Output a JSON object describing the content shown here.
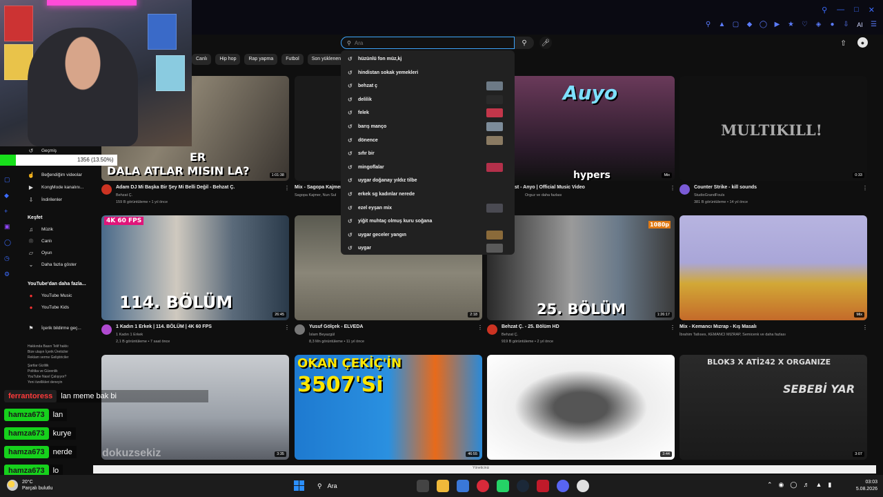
{
  "search": {
    "placeholder": "Ara",
    "suggestions": [
      {
        "text": "hüzünlü fon müz,kj",
        "thumb": ""
      },
      {
        "text": "hindistan sokak yemekleri",
        "thumb": ""
      },
      {
        "text": "behzat ç",
        "thumb": "#6d7a86"
      },
      {
        "text": "delilik",
        "thumb": "#2a2a2a"
      },
      {
        "text": "felek",
        "thumb": "#c3364a"
      },
      {
        "text": "barış manço",
        "thumb": "#7d8c9a"
      },
      {
        "text": "dönence",
        "thumb": "#8a7a62"
      },
      {
        "text": "sıfır bir",
        "thumb": ""
      },
      {
        "text": "mingoflalar",
        "thumb": "#b3304a"
      },
      {
        "text": "uygar doğanay yıldız tilbe",
        "thumb": ""
      },
      {
        "text": "erkek sg kadınlar nerede",
        "thumb": ""
      },
      {
        "text": "ezel eyşan mix",
        "thumb": "#4a4a52"
      },
      {
        "text": "yiğit muhtaç olmuş kuru soğana",
        "thumb": ""
      },
      {
        "text": "uygar geceler yangın",
        "thumb": "#8a6a3a"
      },
      {
        "text": "uygar",
        "thumb": "#5a5a5a"
      }
    ]
  },
  "chips": [
    "Canlı",
    "Hip hop",
    "Rap yapma",
    "Futbol",
    "Son yüklenenler"
  ],
  "sidebar": {
    "history": "Geçmiş",
    "items": [
      {
        "label": "Beğendiğim videolar",
        "icon": "thumb-up-icon"
      },
      {
        "label": "KongMode kanalını...",
        "icon": "play-square-icon"
      },
      {
        "label": "İndirilenler",
        "icon": "download-icon"
      }
    ],
    "explore_title": "Keşfet",
    "explore": [
      {
        "label": "Müzik",
        "icon": "music-icon"
      },
      {
        "label": "Canlı",
        "icon": "live-icon"
      },
      {
        "label": "Oyun",
        "icon": "gamepad-icon"
      },
      {
        "label": "Daha fazla göster",
        "icon": "chevron-down-icon"
      }
    ],
    "more_title": "YouTube'dan daha fazla...",
    "more": [
      {
        "label": "YouTube Music",
        "icon": "yt-music-icon"
      },
      {
        "label": "YouTube Kids",
        "icon": "yt-kids-icon"
      }
    ],
    "report": "İçerik bildirme geç...",
    "footer": [
      "Hakkında  Basın  Telif hakkı",
      "Bize ulaşın  İçerik Üreticiler",
      "Reklam verme  Geliştiriciler",
      "",
      "Şartlar  Gizlilik",
      "Politika ve Güvenlik",
      "YouTube Nasıl Çalışıyor?",
      "Yeni özellikleri deneyin"
    ]
  },
  "progress": {
    "text": "1356 (13.50%)",
    "fraction": 0.135
  },
  "videos": [
    {
      "title": "Adam DJ Mi Başka Bir Şey Mi Belli Değil - Behzat Ç.",
      "channel": "Behzat Ç.",
      "meta": "159 B görüntüleme • 1 yıl önce",
      "duration": "1:01:38",
      "overlay": "DALA ATLAR MISIN LA?",
      "overlay2": "ER"
    },
    {
      "title": "Mix - Sagopa Kajmer",
      "channel": "Sagopa Kajmer, Nun Sul",
      "meta": "",
      "duration": "",
      "overlay": "",
      "overlay2": ""
    },
    {
      "title": "st - Anyo | Official Music Video",
      "channel": "Orguz ve daha fazlası",
      "meta": "",
      "duration": "Mix",
      "overlay": "Auyo",
      "overlay2": "hypers"
    },
    {
      "title": "Counter Strike - kill sounds",
      "channel": "StudioGrandFouls",
      "meta": "381 B görüntüleme • 14 yıl önce",
      "duration": "0:33",
      "overlay": "MULTIKILL!",
      "overlay2": ""
    },
    {
      "title": "1 Kadın 1 Erkek | 114. BÖLÜM | 4K 60 FPS",
      "channel": "1 Kadın 1 Erkek",
      "meta": "2,1 B görüntüleme • 7 saat önce",
      "duration": "26:45",
      "overlay": "114. BÖLÜM",
      "overlay2": "4K 60 FPS"
    },
    {
      "title": "Yusuf Gölçek - ELVEDA",
      "channel": "İslam Beyazgül",
      "meta": "8,3 Mn görüntüleme • 11 yıl önce",
      "duration": "2:18",
      "overlay": "",
      "overlay2": ""
    },
    {
      "title": "Behzat Ç. - 25. Bölüm HD",
      "channel": "Behzat Ç.",
      "meta": "919 B görüntüleme • 2 yıl önce",
      "duration": "1:26:17",
      "overlay": "25. BÖLÜM",
      "overlay2": "1080p"
    },
    {
      "title": "Mix - Kemancı Mızrap - Kış Masalı",
      "channel": "İbrahim Tatlıses, KEMANCI MIZRAP, Semicenk ve daha fazlası",
      "meta": "",
      "duration": "Mix",
      "overlay": "",
      "overlay2": ""
    },
    {
      "title": "",
      "channel": "",
      "meta": "",
      "duration": "3:35",
      "overlay": "dokuzsekiz",
      "overlay2": ""
    },
    {
      "title": "",
      "channel": "",
      "meta": "",
      "duration": "46:55",
      "overlay": "OKAN ÇEKİÇ'İN",
      "overlay2": "3507'Si"
    },
    {
      "title": "",
      "channel": "",
      "meta": "",
      "duration": "3:44",
      "overlay": "",
      "overlay2": ""
    },
    {
      "title": "",
      "channel": "",
      "meta": "",
      "duration": "3:07",
      "overlay": "BLOK3 X ATİ242 X ORGANIZE",
      "overlay2": "SEBEBİ YAR"
    }
  ],
  "chat": [
    {
      "name": "ferrantoress",
      "msg": "lan meme bak bi"
    },
    {
      "name": "hamza673",
      "msg": "lan"
    },
    {
      "name": "hamza673",
      "msg": "kurye"
    },
    {
      "name": "hamza673",
      "msg": "nerde"
    },
    {
      "name": "hamza673",
      "msg": "lo"
    }
  ],
  "bottom_strip": "Yöneticiniz",
  "taskbar": {
    "temp": "20°C",
    "weather": "Parçalı bulutlu",
    "search": "Ara",
    "time": "03:03",
    "date": "5.08.2026"
  },
  "browser": {
    "ext_label": "AI"
  },
  "colors": {
    "accent": "#3ea6ff",
    "chat_green": "#16d11c",
    "progress": "#18e01b",
    "extension_blue": "#5b7cff"
  }
}
